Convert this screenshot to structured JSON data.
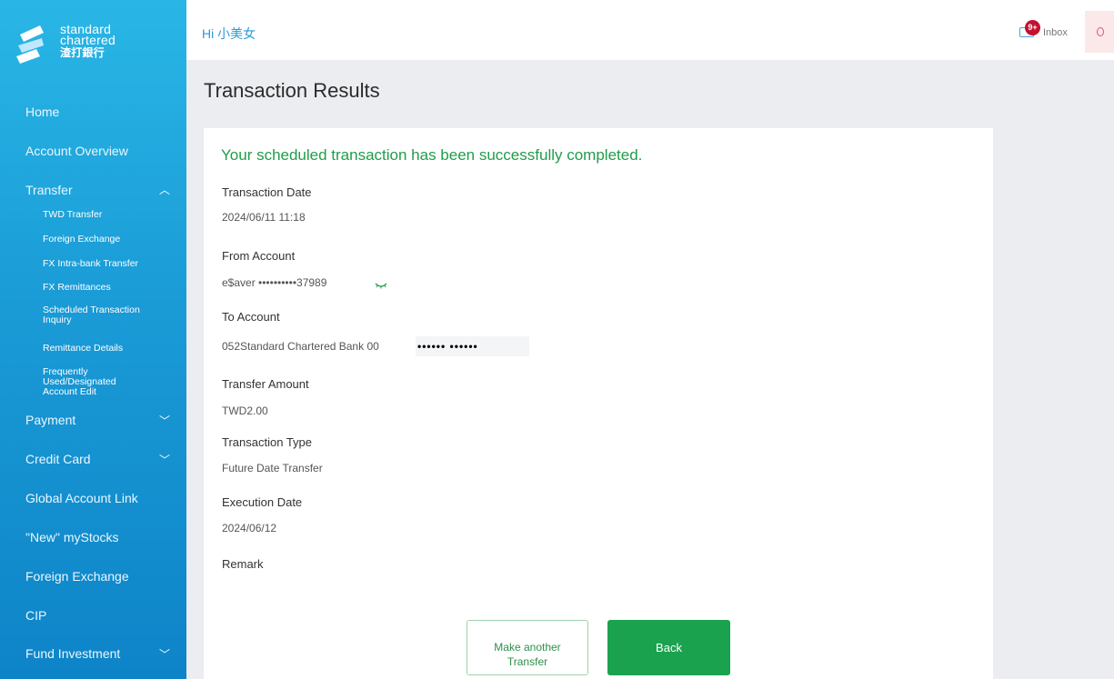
{
  "brand": {
    "line1": "standard",
    "line2": "chartered",
    "line3": "渣打銀行"
  },
  "header": {
    "greeting": "Hi 小美女",
    "inbox_label": "Inbox",
    "inbox_badge": "9+"
  },
  "sidebar": {
    "items": [
      {
        "label": "Home"
      },
      {
        "label": "Account Overview"
      },
      {
        "label": "Transfer"
      },
      {
        "label": "Payment"
      },
      {
        "label": "Credit Card"
      },
      {
        "label": "Global Account Link"
      },
      {
        "label": "\"New\" myStocks"
      },
      {
        "label": "Foreign Exchange"
      },
      {
        "label": "CIP"
      },
      {
        "label": "Fund Investment"
      }
    ],
    "transfer_sub": [
      {
        "label": "TWD Transfer"
      },
      {
        "label": "Foreign Exchange"
      },
      {
        "label": "FX Intra-bank Transfer"
      },
      {
        "label": "FX Remittances"
      },
      {
        "label": "Scheduled Transaction Inquiry"
      },
      {
        "label": "Remittance Details"
      },
      {
        "label": "Frequently Used/Designated Account Edit"
      }
    ]
  },
  "page": {
    "title": "Transaction Results"
  },
  "result": {
    "message": "Your scheduled transaction has been successfully completed.",
    "fields": [
      {
        "label": "Transaction Date",
        "value": "2024/06/11 11:18"
      },
      {
        "label": "From Account",
        "value": "e$aver ••••••••••37989"
      },
      {
        "label": "To Account",
        "value": "052Standard Chartered Bank 00"
      },
      {
        "label": "Transfer Amount",
        "value": "TWD2.00"
      },
      {
        "label": "Transaction Type",
        "value": "Future Date Transfer"
      },
      {
        "label": "Execution Date",
        "value": "2024/06/12"
      },
      {
        "label": "Remark",
        "value": ""
      }
    ],
    "to_account_masked": "•••••• ••••••"
  },
  "actions": {
    "another_line1": "Make another",
    "another_line2": "Transfer",
    "back": "Back"
  },
  "colors": {
    "success": "#1f9d49",
    "primary_button": "#1ba24f",
    "sidebar": "#1a9bd6"
  }
}
